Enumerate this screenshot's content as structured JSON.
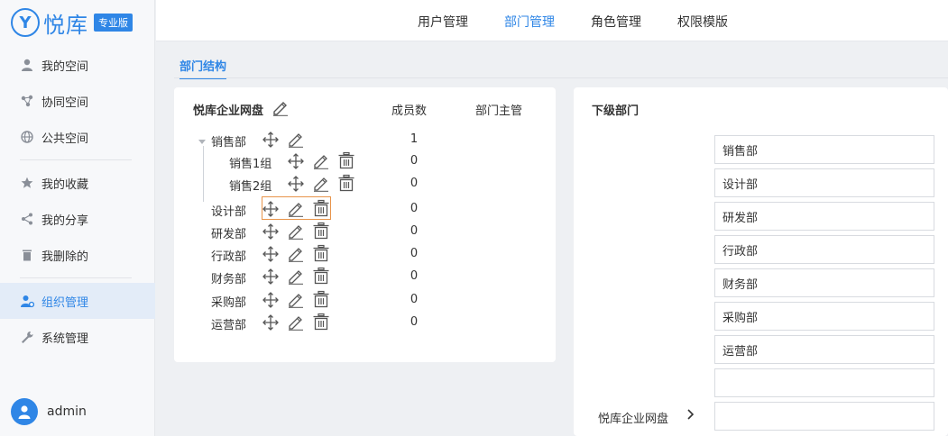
{
  "app": {
    "logo_glyph": "Y",
    "name": "悦库",
    "edition": "专业版"
  },
  "sidebar": {
    "items": [
      {
        "label": "我的空间",
        "icon": "user-icon"
      },
      {
        "label": "协同空间",
        "icon": "share-nodes-icon"
      },
      {
        "label": "公共空间",
        "icon": "globe-icon"
      },
      {
        "label": "我的收藏",
        "icon": "star-icon"
      },
      {
        "label": "我的分享",
        "icon": "share-icon"
      },
      {
        "label": "我删除的",
        "icon": "trash-icon"
      },
      {
        "label": "组织管理",
        "icon": "org-user-icon",
        "active": true
      },
      {
        "label": "系统管理",
        "icon": "wrench-icon"
      }
    ],
    "user": {
      "name": "admin"
    }
  },
  "top_tabs": [
    {
      "label": "用户管理"
    },
    {
      "label": "部门管理",
      "active": true
    },
    {
      "label": "角色管理"
    },
    {
      "label": "权限模版"
    }
  ],
  "subtab": {
    "label": "部门结构"
  },
  "org_panel": {
    "title": "悦库企业网盘",
    "col_members": "成员数",
    "col_manager": "部门主管",
    "rows": [
      {
        "name": "销售部",
        "count": "1"
      },
      {
        "name": "销售1组",
        "count": "0"
      },
      {
        "name": "销售2组",
        "count": "0"
      },
      {
        "name": "设计部",
        "count": "0"
      },
      {
        "name": "研发部",
        "count": "0"
      },
      {
        "name": "行政部",
        "count": "0"
      },
      {
        "name": "财务部",
        "count": "0"
      },
      {
        "name": "采购部",
        "count": "0"
      },
      {
        "name": "运营部",
        "count": "0"
      }
    ]
  },
  "sub_panel": {
    "title": "下级部门",
    "fields": [
      "销售部",
      "设计部",
      "研发部",
      "行政部",
      "财务部",
      "采购部",
      "运营部",
      "",
      ""
    ],
    "breadcrumb": "悦库企业网盘"
  },
  "colors": {
    "accent": "#2f86e6",
    "highlight": "#e8944a"
  }
}
